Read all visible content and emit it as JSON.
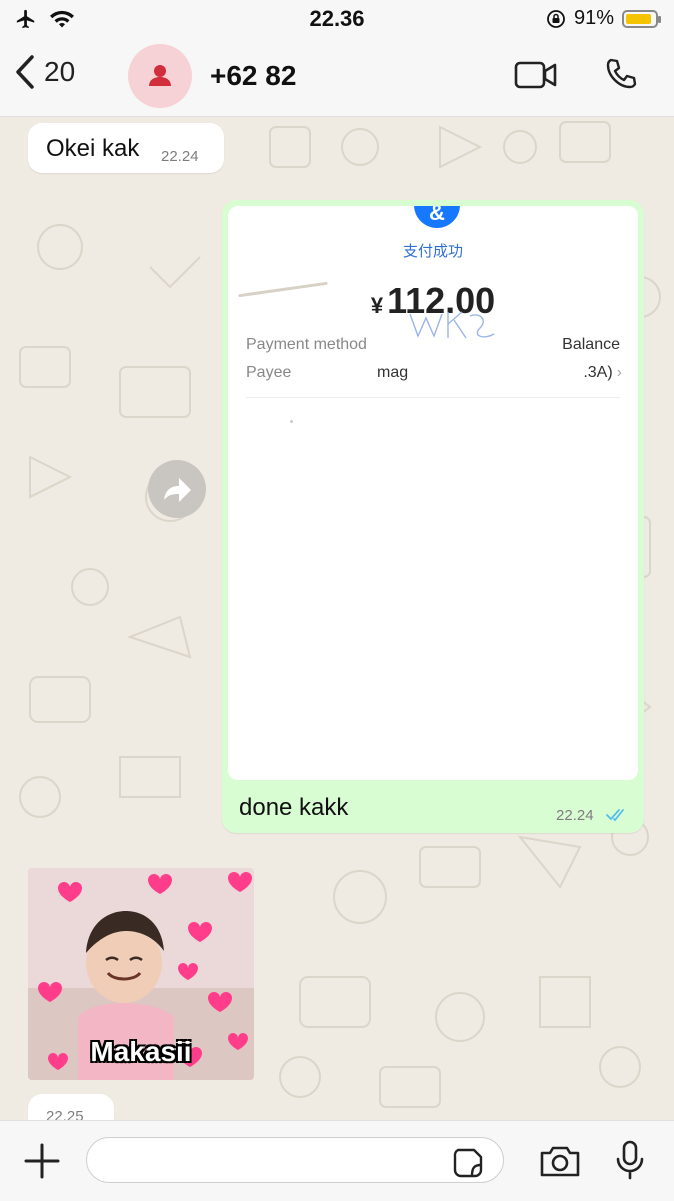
{
  "status_bar": {
    "time": "22.36",
    "battery": "91%",
    "battery_level": 0.91
  },
  "header": {
    "back_count": "20",
    "contact_name": "+62 82"
  },
  "messages": {
    "incoming_1": {
      "text": "Okei kak",
      "time": "22.24"
    },
    "outgoing_1": {
      "caption": "done kakk",
      "time": "22.24",
      "receipt": {
        "status": "支付成功",
        "currency": "¥",
        "amount": "112.00",
        "rows": [
          {
            "label": "Payment method",
            "value": "Balance"
          },
          {
            "label": "Payee",
            "value": "mag",
            "value_right": ".3A)"
          }
        ]
      }
    },
    "sticker": {
      "text": "Makasii"
    },
    "incoming_2": {
      "time": "22.25"
    }
  },
  "input": {
    "placeholder": ""
  },
  "colors": {
    "chat_background": "#efeae2",
    "outgoing_bubble": "#d9fdd3",
    "read_ticks": "#53bdeb",
    "alipay_blue": "#1677ff",
    "avatar_bg": "#f6d2d6",
    "avatar_icon": "#d12d3a"
  },
  "icons": [
    "airplane-icon",
    "wifi-icon",
    "lock-rotation-icon",
    "battery-icon",
    "back-chevron-icon",
    "person-icon",
    "video-call-icon",
    "phone-icon",
    "forward-icon",
    "read-ticks-icon",
    "plus-icon",
    "sticker-icon",
    "camera-icon",
    "microphone-icon"
  ]
}
